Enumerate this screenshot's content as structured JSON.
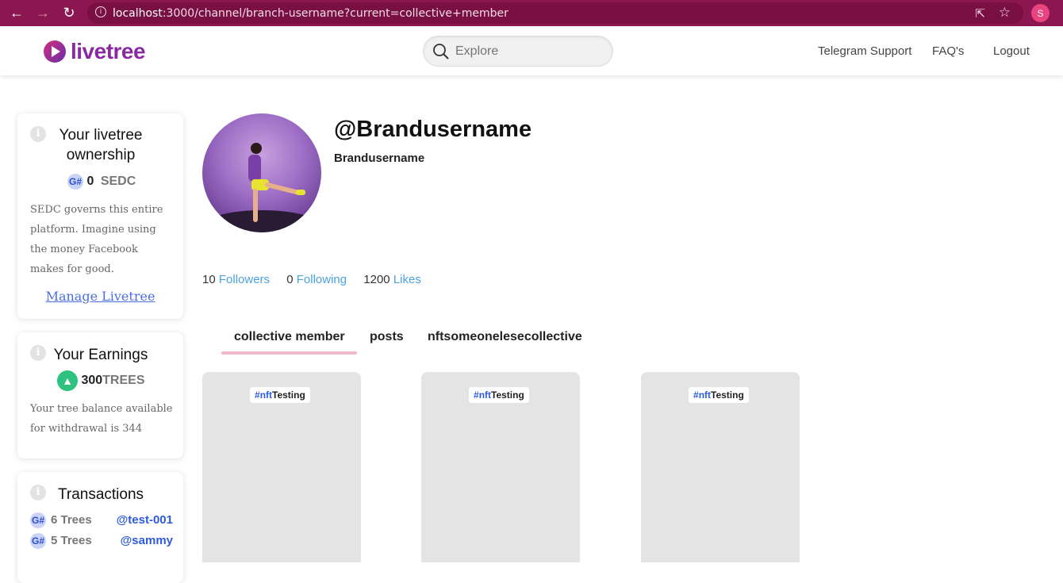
{
  "browser": {
    "url_host": "localhost",
    "url_rest": ":3000/channel/branch-username?current=collective+member",
    "profile_initial": "S"
  },
  "header": {
    "logo_text": "livetree",
    "search_placeholder": "Explore",
    "links": [
      "Telegram Support",
      "FAQ's",
      "Logout"
    ]
  },
  "sidebar": {
    "ownership": {
      "title_line1": "Your livetree",
      "title_line2": "ownership",
      "amount": "0",
      "unit": "SEDC",
      "description": "SEDC governs this entire platform. Imagine using the money Facebook makes for good.",
      "link": "Manage Livetree"
    },
    "earnings": {
      "title": "Your Earnings",
      "amount": "300",
      "unit": "TREES",
      "description": "Your tree balance available for withdrawal is 344"
    },
    "transactions": {
      "title": "Transactions",
      "items": [
        {
          "amount": "6 Trees",
          "user": "@test-001"
        },
        {
          "amount": "5 Trees",
          "user": "@sammy"
        }
      ]
    }
  },
  "profile": {
    "handle": "@Brandusername",
    "name": "Brandusername",
    "followers_count": "10",
    "followers_label": "Followers",
    "following_count": "0",
    "following_label": "Following",
    "likes_count": "1200",
    "likes_label": "Likes"
  },
  "tabs": [
    "collective member",
    "posts",
    "nftsomeonelesecollective"
  ],
  "active_tab": "collective member",
  "cards": [
    {
      "tag_hash": "#",
      "tag_nft": "nft",
      "tag_rest": "Testing"
    },
    {
      "tag_hash": "#",
      "tag_nft": "nft",
      "tag_rest": "Testing"
    },
    {
      "tag_hash": "#",
      "tag_nft": "nft",
      "tag_rest": "Testing"
    }
  ],
  "colors": {
    "browser_bar": "#8c1650",
    "brand": "#8a2aa0",
    "link_blue": "#4aa3df",
    "tab_underline": "#f0b8c9"
  }
}
